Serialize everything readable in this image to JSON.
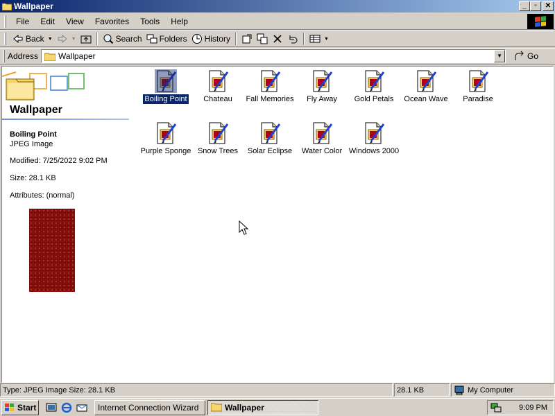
{
  "window": {
    "title": "Wallpaper",
    "buttons": {
      "minimize": "_",
      "maximize": "▫",
      "close": "✕"
    }
  },
  "menu": [
    "File",
    "Edit",
    "View",
    "Favorites",
    "Tools",
    "Help"
  ],
  "toolbar": {
    "back": "Back",
    "search": "Search",
    "folders": "Folders",
    "history": "History"
  },
  "address": {
    "label": "Address",
    "value": "Wallpaper",
    "go": "Go"
  },
  "left_pane": {
    "title": "Wallpaper",
    "selected_name": "Boiling Point",
    "selected_type": "JPEG Image",
    "modified": "Modified: 7/25/2022 9:02 PM",
    "size": "Size: 28.1 KB",
    "attributes": "Attributes: (normal)"
  },
  "files": [
    {
      "name": "Boiling Point",
      "selected": true
    },
    {
      "name": "Chateau"
    },
    {
      "name": "Fall Memories"
    },
    {
      "name": "Fly Away"
    },
    {
      "name": "Gold Petals"
    },
    {
      "name": "Ocean Wave"
    },
    {
      "name": "Paradise"
    },
    {
      "name": "Purple Sponge"
    },
    {
      "name": "Snow Trees"
    },
    {
      "name": "Solar Eclipse"
    },
    {
      "name": "Water Color"
    },
    {
      "name": "Windows 2000"
    }
  ],
  "status": {
    "info": "Type: JPEG Image Size: 28.1 KB",
    "size": "28.1 KB",
    "zone": "My Computer"
  },
  "taskbar": {
    "start": "Start",
    "tasks": [
      "Internet Connection Wizard",
      "Wallpaper"
    ],
    "time": "9:09 PM"
  },
  "colors": {
    "title_start": "#0a246a",
    "title_end": "#a6caf0",
    "selection": "#0a246a",
    "face": "#d4d0c8"
  }
}
